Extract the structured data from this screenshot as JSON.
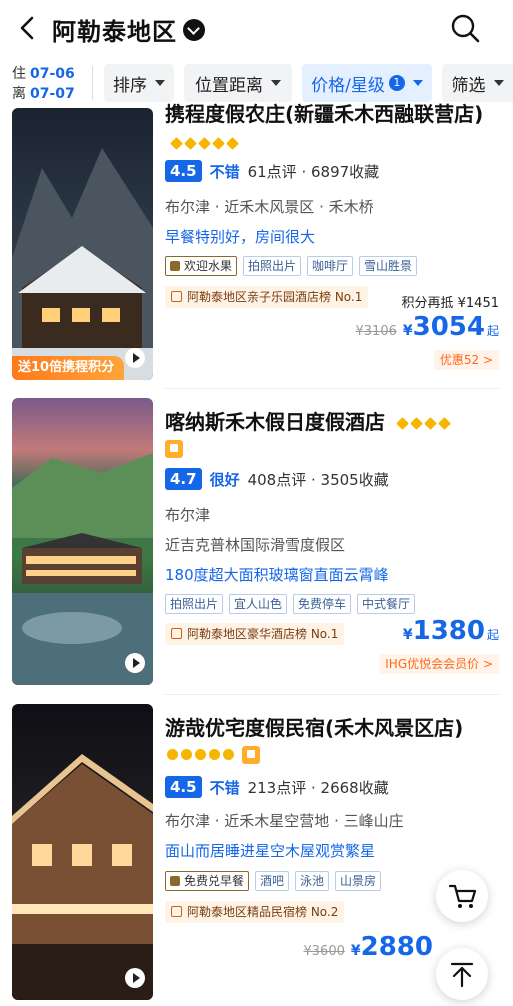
{
  "header": {
    "title": "阿勒泰地区",
    "back_icon": "back-arrow-icon",
    "search_icon": "search-icon"
  },
  "filters": {
    "checkin_label": "住",
    "checkin_date": "07-06",
    "checkout_label": "离",
    "checkout_date": "07-07",
    "sort": "排序",
    "distance": "位置距离",
    "price_star": "价格/星级",
    "price_star_count": "1",
    "filter": "筛选"
  },
  "hotels": [
    {
      "name": "携程度假农庄(新疆禾木西融联营店)",
      "star_type": "diamond",
      "stars": 5,
      "score": "4.5",
      "score_word": "不错",
      "reviews": "61点评 · 6897收藏",
      "location": "布尔津 · 近禾木风景区 · 禾木桥",
      "tagline": "早餐特别好，房间很大",
      "tags": [
        "欢迎水果",
        "拍照出片",
        "咖啡厅",
        "雪山胜景"
      ],
      "rank": "阿勒泰地区亲子乐园酒店榜 No.1",
      "points_text": "积分再抵 ¥1451",
      "old_price": "¥3106",
      "currency": "¥",
      "price": "3054",
      "price_suffix": "起",
      "discount": "优惠52 >",
      "ribbon": "送10倍携程积分"
    },
    {
      "name": "喀纳斯禾木假日度假酒店",
      "star_type": "diamond",
      "stars": 4,
      "score": "4.7",
      "score_word": "很好",
      "reviews": "408点评 · 3505收藏",
      "location": "布尔津",
      "location2": "近吉克普林国际滑雪度假区",
      "tagline": "180度超大面积玻璃窗直面云霄峰",
      "tags": [
        "拍照出片",
        "宜人山色",
        "免费停车",
        "中式餐厅"
      ],
      "rank": "阿勒泰地区豪华酒店榜 No.1",
      "currency": "¥",
      "price": "1380",
      "price_suffix": "起",
      "discount": "IHG优悦会会员价 >"
    },
    {
      "name": "游哉优宅度假民宿(禾木风景区店)",
      "star_type": "dot",
      "stars": 5,
      "score": "4.5",
      "score_word": "不错",
      "reviews": "213点评 · 2668收藏",
      "location": "布尔津 · 近禾木星空营地 · 三峰山庄",
      "tagline": "面山而居睡进星空木屋观赏繁星",
      "tags": [
        "免费兑早餐",
        "酒吧",
        "泳池",
        "山景房"
      ],
      "rank": "阿勒泰地区精品民宿榜 No.2",
      "old_price": "¥3600",
      "currency": "¥",
      "price": "2880",
      "price_suffix": "起"
    }
  ],
  "floating": {
    "cart_icon": "shopping-cart-icon",
    "top_icon": "back-to-top-icon"
  },
  "colors": {
    "accent": "#1667e8",
    "star": "#f7b500",
    "orange": "#ff6a1a"
  }
}
